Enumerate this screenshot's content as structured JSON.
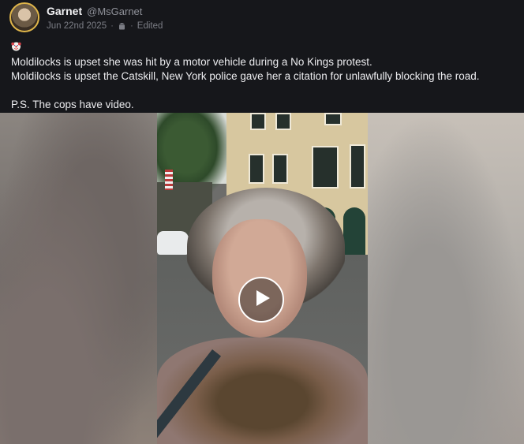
{
  "post": {
    "author": {
      "display_name": "Garnet",
      "handle": "@MsGarnet",
      "avatar_icon": "avatar-image"
    },
    "date": "Jun 22nd 2025",
    "separator": "·",
    "client_icon": "android-icon",
    "edited_label": "Edited",
    "emoji_icon": "clown-face-icon",
    "lines": [
      "Moldilocks is upset she was hit by a motor vehicle during a No Kings protest.",
      "Moldilocks is upset the Catskill, New York police gave her a citation for unlawfully blocking the road.",
      "P.S. The cops have video."
    ],
    "media": {
      "type": "video",
      "play_icon": "play-icon"
    }
  },
  "colors": {
    "background": "#16171b",
    "avatar_ring": "#e0b64a",
    "muted_text": "#8f9199"
  }
}
